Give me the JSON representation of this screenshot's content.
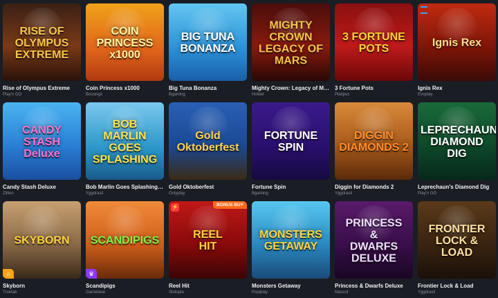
{
  "games": [
    {
      "title": "Rise of Olympus Extreme",
      "provider": "Play'n GO",
      "logo": "RISE OF\nOLYMPUS\nEXTREME",
      "bg": "linear-gradient(180deg,#3a2016 0%,#7a3a16 55%,#2a120a 100%)",
      "color": "#f7c44a"
    },
    {
      "title": "Coin Princess x1000",
      "provider": "Booongo",
      "logo": "COIN\nPRINCESS\nx1000",
      "bg": "linear-gradient(180deg,#f0a21a 0%,#e0641a 60%,#b23a10 100%)",
      "color": "#fff3a0"
    },
    {
      "title": "Big Tuna Bonanza",
      "provider": "Bgaming",
      "logo": "BIG TUNA\nBONANZA",
      "bg": "linear-gradient(180deg,#63c6f0 0%,#2a8fd6 60%,#1a5fa8 100%)",
      "color": "#ffffff"
    },
    {
      "title": "Mighty Crown: Legacy of Mars",
      "provider": "Hotbet",
      "logo": "MIGHTY CROWN\nLEGACY OF MARS",
      "bg": "linear-gradient(180deg,#4a0e0c 0%,#8a1a0e 55%,#2a0806 100%)",
      "color": "#f6c54a"
    },
    {
      "title": "3 Fortune Pots",
      "provider": "Platipus",
      "logo": "3 FORTUNE\nPOTS",
      "bg": "linear-gradient(180deg,#8a1010 0%,#c01a1a 55%,#6a0808 100%)",
      "color": "#ffd23a"
    },
    {
      "title": "Ignis Rex",
      "provider": "Evoplay",
      "logo": "Ignis Rex",
      "bg": "linear-gradient(180deg,#c02a10 0%,#7a1408 60%,#3a0a06 100%)",
      "color": "#ffe08a"
    },
    {
      "title": "Candy Stash Deluxe",
      "provider": "Zillion",
      "logo": "CANDY\nSTASH\nDeluxe",
      "bg": "linear-gradient(180deg,#4ab4f0 0%,#2a80d6 55%,#1a4fa0 100%)",
      "color": "#ff6fc9"
    },
    {
      "title": "Bob Marlin Goes Splashing Wild",
      "provider": "Yggdrasil",
      "logo": "BOB\nMARLIN\nGOES SPLASHING",
      "bg": "linear-gradient(180deg,#7ac8ee 0%,#2a96c8 60%,#1a5a8a 100%)",
      "color": "#ffe24a"
    },
    {
      "title": "Gold Oktoberfest",
      "provider": "Onlyplay",
      "logo": "Gold\nOktoberfest",
      "bg": "linear-gradient(180deg,#2a5fb4 0%,#1a4a96 55%,#3a2a14 100%)",
      "color": "#ffd24a"
    },
    {
      "title": "Fortune Spin",
      "provider": "Bgaming",
      "logo": "FORTUNE\nSPIN",
      "bg": "linear-gradient(180deg,#3a1a8a 0%,#2a1070 55%,#160a40 100%)",
      "color": "#ffffff"
    },
    {
      "title": "Diggin for Diamonds 2",
      "provider": "Yggdrasil",
      "logo": "DIGGIN\nDIAMONDS 2",
      "bg": "linear-gradient(180deg,#d88a3a 0%,#a85a1a 55%,#5a2a0a 100%)",
      "color": "#ff8a2a"
    },
    {
      "title": "Leprechaun's Diamond Dig",
      "provider": "Play'n GO",
      "logo": "LEPRECHAUN'S\nDIAMOND\nDIG",
      "bg": "linear-gradient(180deg,#1a6a3a 0%,#0e4a2a 55%,#06281a 100%)",
      "color": "#ffffff"
    },
    {
      "title": "Skyborn",
      "provider": "Truelab",
      "logo": "SKYBORN",
      "bg": "linear-gradient(180deg,#c8a070 0%,#8a6a48 55%,#3a2a1a 100%)",
      "color": "#ffd23a"
    },
    {
      "title": "Scandipigs",
      "provider": "Gamebeat",
      "logo": "SCANDIPIGS",
      "bg": "linear-gradient(180deg,#f08a3a 0%,#d0601a 55%,#6a2a0a 100%)",
      "color": "#7ff04a"
    },
    {
      "title": "Reel Hit",
      "provider": "Slotopia",
      "logo": "REEL\nHIT",
      "bg": "linear-gradient(180deg,#c01818 0%,#8a0a0a 55%,#3a0404 100%)",
      "color": "#ffd23a"
    },
    {
      "title": "Monsters Getaway",
      "provider": "Popiplay",
      "logo": "MONSTERS\nGETAWAY",
      "bg": "linear-gradient(180deg,#58c8f0 0%,#2a8ac0 55%,#1a4a7a 100%)",
      "color": "#ffd23a"
    },
    {
      "title": "Princess & Dwarfs Deluxe",
      "provider": "Mascot",
      "logo": "PRINCESS\n&\nDWARFS\nDELUXE",
      "bg": "linear-gradient(180deg,#5a1a6a 0%,#3a0e4a 55%,#1a0624 100%)",
      "color": "#f0e0ff"
    },
    {
      "title": "Frontier Lock & Load",
      "provider": "Yggdrasil",
      "logo": "FRONTIER\nLOCK & LOAD",
      "bg": "linear-gradient(180deg,#5a3a1a 0%,#3a2410 55%,#1a1008 100%)",
      "color": "#ffe0a0"
    }
  ],
  "badges": {
    "bonus_buy": "BONUS BUY"
  },
  "icons": {
    "bonus-flag": "⚡",
    "corner-home": "⌂",
    "corner-crown": "♛"
  }
}
